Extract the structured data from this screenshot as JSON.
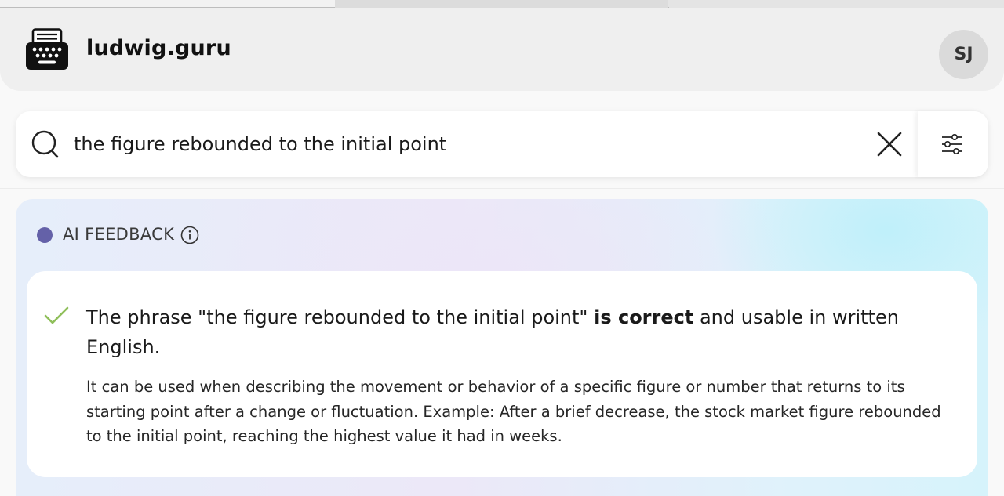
{
  "header": {
    "site_name": "ludwig.guru",
    "logo_icon": "typewriter-icon",
    "avatar_initials": "SJ"
  },
  "search": {
    "query": "the figure rebounded to the initial point",
    "search_icon": "search-icon",
    "clear_icon": "close-icon",
    "filter_icon": "sliders-icon"
  },
  "ai_feedback": {
    "label": "AI FEEDBACK",
    "dot_color": "#6461a8",
    "info_icon": "info-icon",
    "verdict_icon": "check-icon",
    "verdict_color": "#8fbf5a",
    "headline_before": "The phrase \"the figure rebounded to the initial point\" ",
    "headline_bold": "is correct",
    "headline_after": " and usable in written English.",
    "body": "It can be used when describing the movement or behavior of a specific figure or number that returns to its starting point after a change or fluctuation. Example: After a brief decrease, the stock market figure rebounded to the initial point, reaching the highest value it had in weeks."
  }
}
